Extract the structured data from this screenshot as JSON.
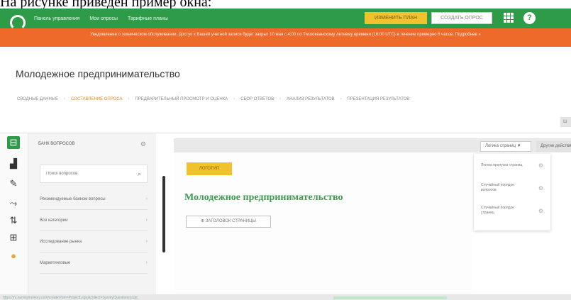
{
  "caption": "На рисунке приведен пример окна:",
  "topbar": {
    "nav": [
      "Панель управления",
      "Мои опросы",
      "Тарифные планы"
    ],
    "upgrade_button": "ИЗМЕНИТЬ ПЛАН",
    "create_button": "СОЗДАТЬ ОПРОС",
    "help_label": "?"
  },
  "banner": {
    "text": "Уведомление о техническом обслуживании. Доступ к Вашей учетной записи будет закрыт 10 мая с 4:00 по Тихоокеанскому летнему времени (16:00 UTC) в течение примерно 6 часов. Подробнее »"
  },
  "page": {
    "title": "Молодежное предпринимательство"
  },
  "steps": [
    "СВОДНЫЕ ДАННЫЕ",
    "СОСТАВЛЕНИЕ ОПРОСА",
    "ПРЕДВАРИТЕЛЬНЫЙ ПРОСМОТР И ОЦЕНКА",
    "СБОР ОТВЕТОВ",
    "АНАЛИЗ РЕЗУЛЬТАТОВ",
    "ПРЕЗЕНТАЦИЯ РЕЗУЛЬТАТОВ"
  ],
  "active_step_index": 1,
  "side_button": "Ш",
  "sidebar_icons": [
    "grid-icon",
    "chart-icon",
    "brush-icon",
    "logic-icon",
    "sort-icon",
    "options-icon",
    "coin-icon"
  ],
  "question_bank": {
    "title": "БАНК ВОПРОСОВ",
    "search_placeholder": "Поиск вопросов",
    "items": [
      "Рекомендуемые банком вопросы",
      "Все категории",
      "Исследование рынка",
      "Маркетинговые"
    ]
  },
  "canvas": {
    "badge": "ЛОГОТИП",
    "survey_title": "Молодежное предпринимательство",
    "header_button": "ЗАГОЛОВОК СТРАНИЦЫ"
  },
  "toolbar": {
    "logic_button": "Логика страниц ▼",
    "other_button": "Другие действия"
  },
  "dropdown": {
    "items": [
      "Логика пропуска страниц",
      "Случайный порядок вопросов",
      "Случайный порядок страниц"
    ]
  },
  "status_link": "https://ru.surveymonkey.com/create/?sm=ProjectLogic&collect=SurveyQuestionsLogic"
}
